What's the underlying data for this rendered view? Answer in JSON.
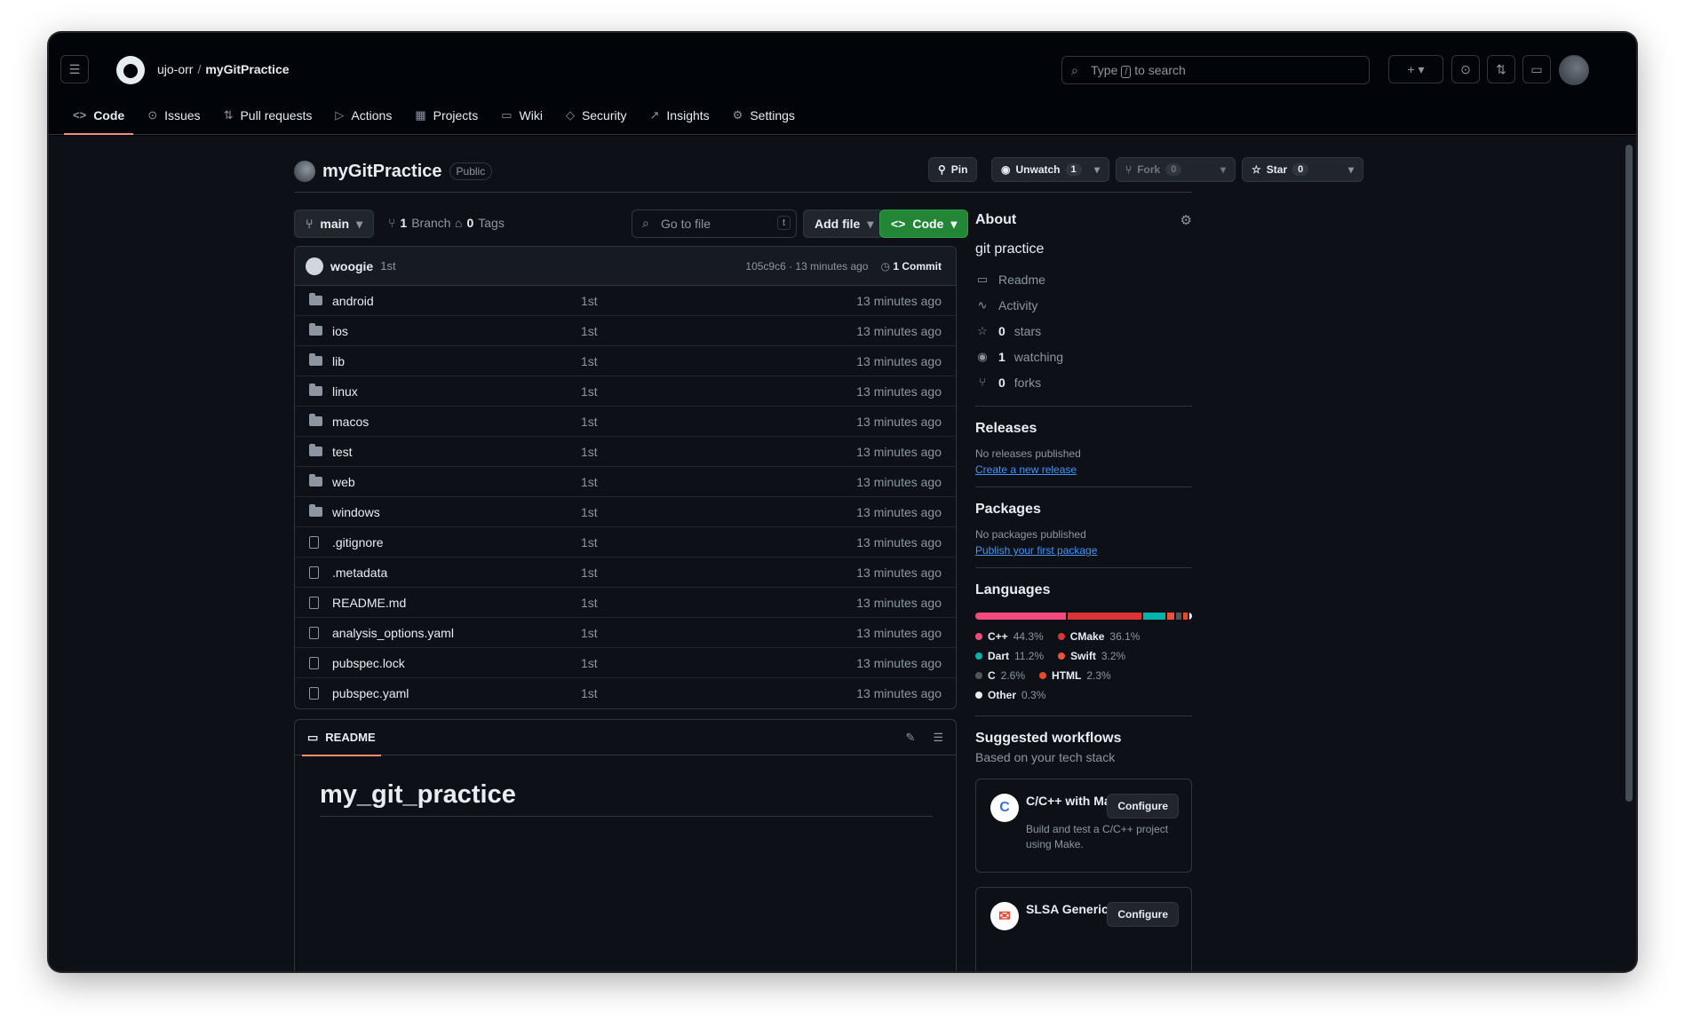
{
  "header": {
    "owner": "ujo-orr",
    "repo": "myGitPractice",
    "search_prefix": "Type",
    "search_key": "/",
    "search_suffix": "to search"
  },
  "nav": [
    {
      "label": "Code",
      "icon": "code-icon",
      "glyph": "<>"
    },
    {
      "label": "Issues",
      "icon": "issue-icon",
      "glyph": "⊙"
    },
    {
      "label": "Pull requests",
      "icon": "pull-request-icon",
      "glyph": "⇅"
    },
    {
      "label": "Actions",
      "icon": "play-icon",
      "glyph": "▷"
    },
    {
      "label": "Projects",
      "icon": "table-icon",
      "glyph": "▦"
    },
    {
      "label": "Wiki",
      "icon": "book-icon",
      "glyph": "▭"
    },
    {
      "label": "Security",
      "icon": "shield-icon",
      "glyph": "◇"
    },
    {
      "label": "Insights",
      "icon": "graph-icon",
      "glyph": "↗"
    },
    {
      "label": "Settings",
      "icon": "gear-icon",
      "glyph": "⚙"
    }
  ],
  "repo": {
    "name": "myGitPractice",
    "visibility": "Public",
    "pin_label": "Pin",
    "unwatch_label": "Unwatch",
    "watch_count": "1",
    "fork_label": "Fork",
    "fork_count": "0",
    "star_label": "Star",
    "star_count": "0"
  },
  "toolbar": {
    "branch": "main",
    "branches_count": "1",
    "branches_label": "Branch",
    "tags_count": "0",
    "tags_label": "Tags",
    "goto_placeholder": "Go to file",
    "goto_key": "t",
    "add_file_label": "Add file",
    "code_label": "Code"
  },
  "commit": {
    "user": "woogie",
    "message": "1st",
    "hash_time": "105c9c6 · 13 minutes ago",
    "commits_label": "1 Commit"
  },
  "files": [
    {
      "name": "android",
      "type": "folder",
      "commit": "1st",
      "time": "13 minutes ago"
    },
    {
      "name": "ios",
      "type": "folder",
      "commit": "1st",
      "time": "13 minutes ago"
    },
    {
      "name": "lib",
      "type": "folder",
      "commit": "1st",
      "time": "13 minutes ago"
    },
    {
      "name": "linux",
      "type": "folder",
      "commit": "1st",
      "time": "13 minutes ago"
    },
    {
      "name": "macos",
      "type": "folder",
      "commit": "1st",
      "time": "13 minutes ago"
    },
    {
      "name": "test",
      "type": "folder",
      "commit": "1st",
      "time": "13 minutes ago"
    },
    {
      "name": "web",
      "type": "folder",
      "commit": "1st",
      "time": "13 minutes ago"
    },
    {
      "name": "windows",
      "type": "folder",
      "commit": "1st",
      "time": "13 minutes ago"
    },
    {
      "name": ".gitignore",
      "type": "file",
      "commit": "1st",
      "time": "13 minutes ago"
    },
    {
      "name": ".metadata",
      "type": "file",
      "commit": "1st",
      "time": "13 minutes ago"
    },
    {
      "name": "README.md",
      "type": "file",
      "commit": "1st",
      "time": "13 minutes ago"
    },
    {
      "name": "analysis_options.yaml",
      "type": "file",
      "commit": "1st",
      "time": "13 minutes ago"
    },
    {
      "name": "pubspec.lock",
      "type": "file",
      "commit": "1st",
      "time": "13 minutes ago"
    },
    {
      "name": "pubspec.yaml",
      "type": "file",
      "commit": "1st",
      "time": "13 minutes ago"
    }
  ],
  "readme": {
    "tab_label": "README",
    "heading": "my_git_practice"
  },
  "about": {
    "title": "About",
    "description": "git practice",
    "items": [
      {
        "icon": "book-icon",
        "glyph": "▭",
        "bold": "",
        "text": "Readme"
      },
      {
        "icon": "pulse-icon",
        "glyph": "∿",
        "bold": "",
        "text": "Activity"
      },
      {
        "icon": "star-icon",
        "glyph": "☆",
        "bold": "0",
        "text": "stars"
      },
      {
        "icon": "eye-icon",
        "glyph": "◉",
        "bold": "1",
        "text": "watching"
      },
      {
        "icon": "fork-icon",
        "glyph": "⑂",
        "bold": "0",
        "text": "forks"
      }
    ]
  },
  "releases": {
    "title": "Releases",
    "empty": "No releases published",
    "link": "Create a new release"
  },
  "packages": {
    "title": "Packages",
    "empty": "No packages published",
    "link": "Publish your first package"
  },
  "languages": {
    "title": "Languages",
    "items": [
      {
        "name": "C++",
        "pct": "44.3%",
        "value": 44.3,
        "color": "#f34b7d"
      },
      {
        "name": "CMake",
        "pct": "36.1%",
        "value": 36.1,
        "color": "#DA3434"
      },
      {
        "name": "Dart",
        "pct": "11.2%",
        "value": 11.2,
        "color": "#00B4AB"
      },
      {
        "name": "Swift",
        "pct": "3.2%",
        "value": 3.2,
        "color": "#F05138"
      },
      {
        "name": "C",
        "pct": "2.6%",
        "value": 2.6,
        "color": "#555555"
      },
      {
        "name": "HTML",
        "pct": "2.3%",
        "value": 2.3,
        "color": "#e34c26"
      },
      {
        "name": "Other",
        "pct": "0.3%",
        "value": 0.3,
        "color": "#ededed"
      }
    ]
  },
  "workflows": {
    "title": "Suggested workflows",
    "subtitle": "Based on your tech stack",
    "items": [
      {
        "title": "C/C++ with Make",
        "desc": "Build and test a C/C++ project using Make.",
        "button": "Configure",
        "icon_glyph": "C",
        "icon_color": "#3a6fd8"
      },
      {
        "title": "SLSA Generic",
        "desc": "",
        "button": "Configure",
        "icon_glyph": "✉",
        "icon_color": "#e5432c"
      }
    ]
  }
}
